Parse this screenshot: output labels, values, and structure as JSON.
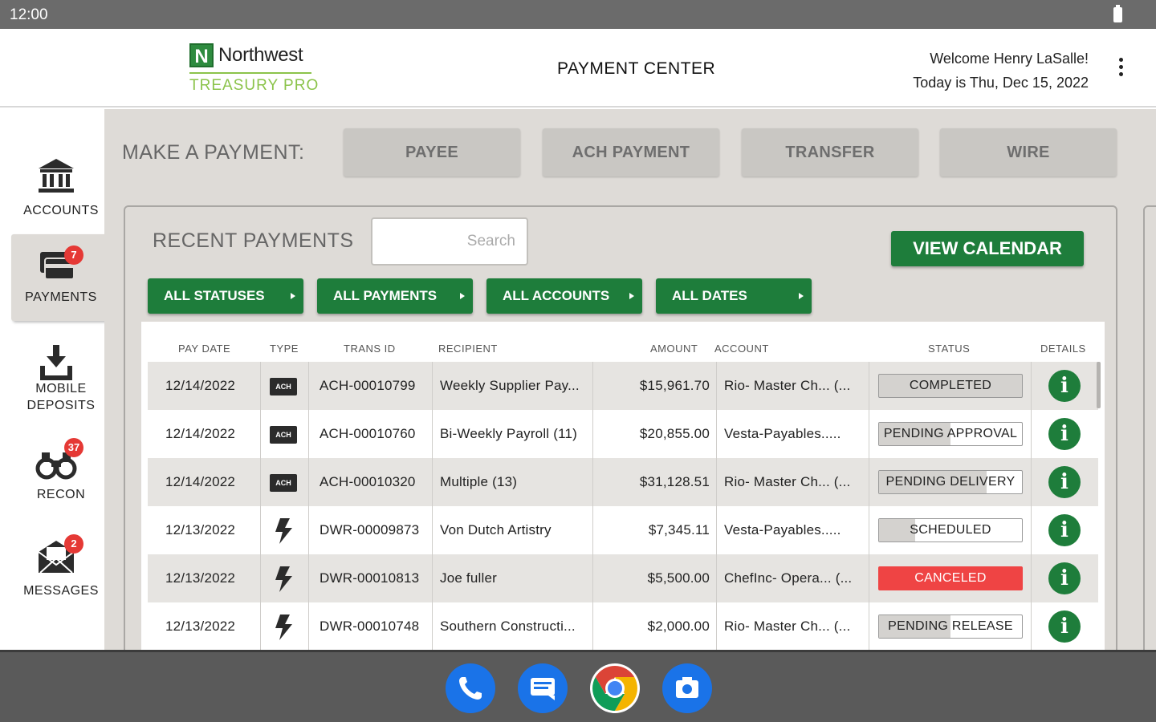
{
  "status_bar": {
    "time": "12:00"
  },
  "header": {
    "logo_letter": "N",
    "logo_name": "Northwest",
    "logo_sub": "TREASURY PRO",
    "title": "PAYMENT CENTER",
    "welcome": "Welcome Henry LaSalle!",
    "date_line": "Today is Thu, Dec 15, 2022"
  },
  "sidebar": {
    "items": [
      {
        "label": "ACCOUNTS",
        "badge": ""
      },
      {
        "label": "PAYMENTS",
        "badge": "7"
      },
      {
        "label": "MOBILE DEPOSITS",
        "badge": ""
      },
      {
        "label": "RECON",
        "badge": "37"
      },
      {
        "label": "MESSAGES",
        "badge": "2"
      }
    ]
  },
  "make_payment": {
    "label": "MAKE A PAYMENT:",
    "buttons": [
      "PAYEE",
      "ACH PAYMENT",
      "TRANSFER",
      "WIRE"
    ]
  },
  "recent": {
    "title": "RECENT PAYMENTS",
    "search_placeholder": "Search",
    "view_calendar": "VIEW CALENDAR",
    "filters": [
      "ALL STATUSES",
      "ALL PAYMENTS",
      "ALL ACCOUNTS",
      "ALL DATES"
    ],
    "columns": [
      "PAY DATE",
      "TYPE",
      "TRANS ID",
      "RECIPIENT",
      "AMOUNT",
      "ACCOUNT",
      "STATUS",
      "DETAILS"
    ],
    "rows": [
      {
        "date": "12/14/2022",
        "type": "ACH",
        "trans_id": "ACH-00010799",
        "recipient": "Weekly Supplier Pay...",
        "amount": "$15,961.70",
        "account": "Rio- Master Ch... (...",
        "status": "COMPLETED",
        "progress": 1.0
      },
      {
        "date": "12/14/2022",
        "type": "ACH",
        "trans_id": "ACH-00010760",
        "recipient": "Bi-Weekly Payroll (11)",
        "amount": "$20,855.00",
        "account": "Vesta-Payables.....",
        "status": "PENDING APPROVAL",
        "progress": 0.5
      },
      {
        "date": "12/14/2022",
        "type": "ACH",
        "trans_id": "ACH-00010320",
        "recipient": "Multiple (13)",
        "amount": "$31,128.51",
        "account": "Rio- Master Ch... (...",
        "status": "PENDING DELIVERY",
        "progress": 0.75
      },
      {
        "date": "12/13/2022",
        "type": "WIRE",
        "trans_id": "DWR-00009873",
        "recipient": "Von Dutch Artistry",
        "amount": "$7,345.11",
        "account": "Vesta-Payables.....",
        "status": "SCHEDULED",
        "progress": 0.25
      },
      {
        "date": "12/13/2022",
        "type": "WIRE",
        "trans_id": "DWR-00010813",
        "recipient": "Joe fuller",
        "amount": "$5,500.00",
        "account": "ChefInc- Opera... (...",
        "status": "CANCELED",
        "progress": 1.0
      },
      {
        "date": "12/13/2022",
        "type": "WIRE",
        "trans_id": "DWR-00010748",
        "recipient": "Southern Constructi...",
        "amount": "$2,000.00",
        "account": "Rio- Master Ch... (...",
        "status": "PENDING RELEASE",
        "progress": 0.5
      }
    ],
    "info_glyph": "i"
  },
  "dock": {
    "apps": [
      "phone-icon",
      "messages-icon",
      "chrome-icon",
      "camera-icon"
    ]
  },
  "colors": {
    "brand_green": "#1e7d3b",
    "logo_green": "#8bc34a",
    "badge_red": "#e53935",
    "cancel_red": "#ef4444"
  }
}
